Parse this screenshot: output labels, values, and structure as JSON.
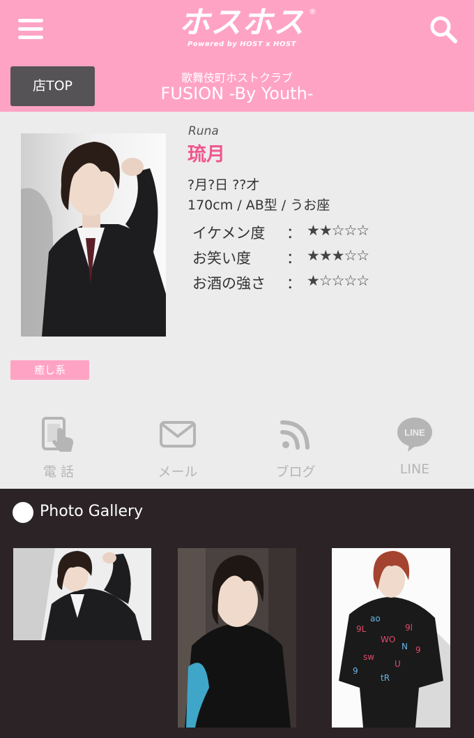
{
  "header": {
    "logo_text": "ホスホス",
    "logo_tagline": "Powered by HOST x HOST",
    "logo_reg": "®",
    "store_top_label": "店TOP",
    "store_subtitle": "歌舞伎町ホストクラブ",
    "store_name": "FUSION -By Youth-",
    "menu_icon": "hamburger-menu-icon",
    "search_icon": "search-icon",
    "brand_color": "#ffa3c4"
  },
  "profile": {
    "romaji": "Runa",
    "name": "琉月",
    "birth": "?月?日 ??才",
    "body": "170cm / AB型 / うお座",
    "name_color": "#f0568f",
    "ratings": [
      {
        "label": "イケメン度",
        "colon": "：",
        "stars": "★★☆☆☆",
        "value": 2,
        "max": 5
      },
      {
        "label": "お笑い度",
        "colon": "：",
        "stars": "★★★☆☆",
        "value": 3,
        "max": 5
      },
      {
        "label": "お酒の強さ",
        "colon": "：",
        "stars": "★☆☆☆☆",
        "value": 1,
        "max": 5
      }
    ],
    "tag": "癒し系"
  },
  "contacts": [
    {
      "label": "電 話",
      "icon": "phone-tap-icon"
    },
    {
      "label": "メール",
      "icon": "mail-icon"
    },
    {
      "label": "ブログ",
      "icon": "rss-icon"
    },
    {
      "label": "LINE",
      "icon": "line-icon",
      "icon_text": "LINE"
    }
  ],
  "gallery": {
    "title": "Photo Gallery",
    "background": "#2b2325"
  }
}
